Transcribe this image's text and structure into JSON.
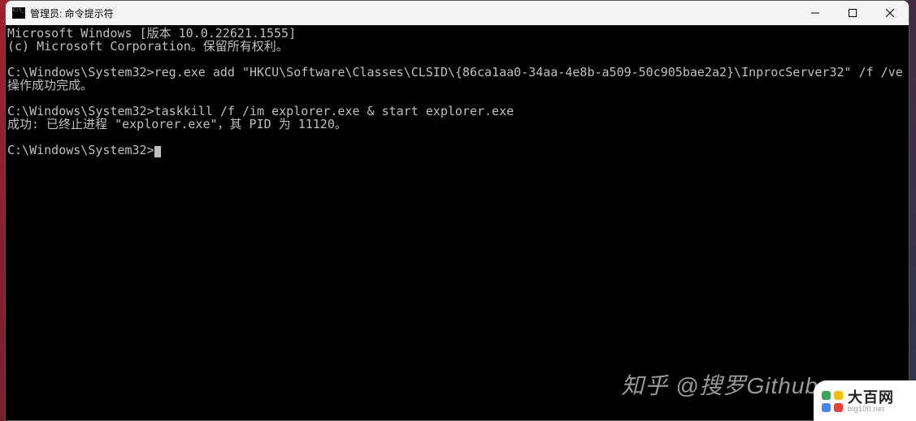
{
  "window": {
    "title": "管理员: 命令提示符"
  },
  "terminal": {
    "header_line1": "Microsoft Windows [版本 10.0.22621.1555]",
    "header_line2": "(c) Microsoft Corporation。保留所有权利。",
    "prompt1": "C:\\Windows\\System32>",
    "cmd1": "reg.exe add \"HKCU\\Software\\Classes\\CLSID\\{86ca1aa0-34aa-4e8b-a509-50c905bae2a2}\\InprocServer32\" /f /ve",
    "out1": "操作成功完成。",
    "prompt2": "C:\\Windows\\System32>",
    "cmd2": "taskkill /f /im explorer.exe & start explorer.exe",
    "out2": "成功: 已终止进程 \"explorer.exe\"，其 PID 为 11120。",
    "prompt3": "C:\\Windows\\System32>"
  },
  "watermark": {
    "zhihu": "知乎 @搜罗Github",
    "big100_cn": "大百网",
    "big100_en": "big100.net"
  }
}
